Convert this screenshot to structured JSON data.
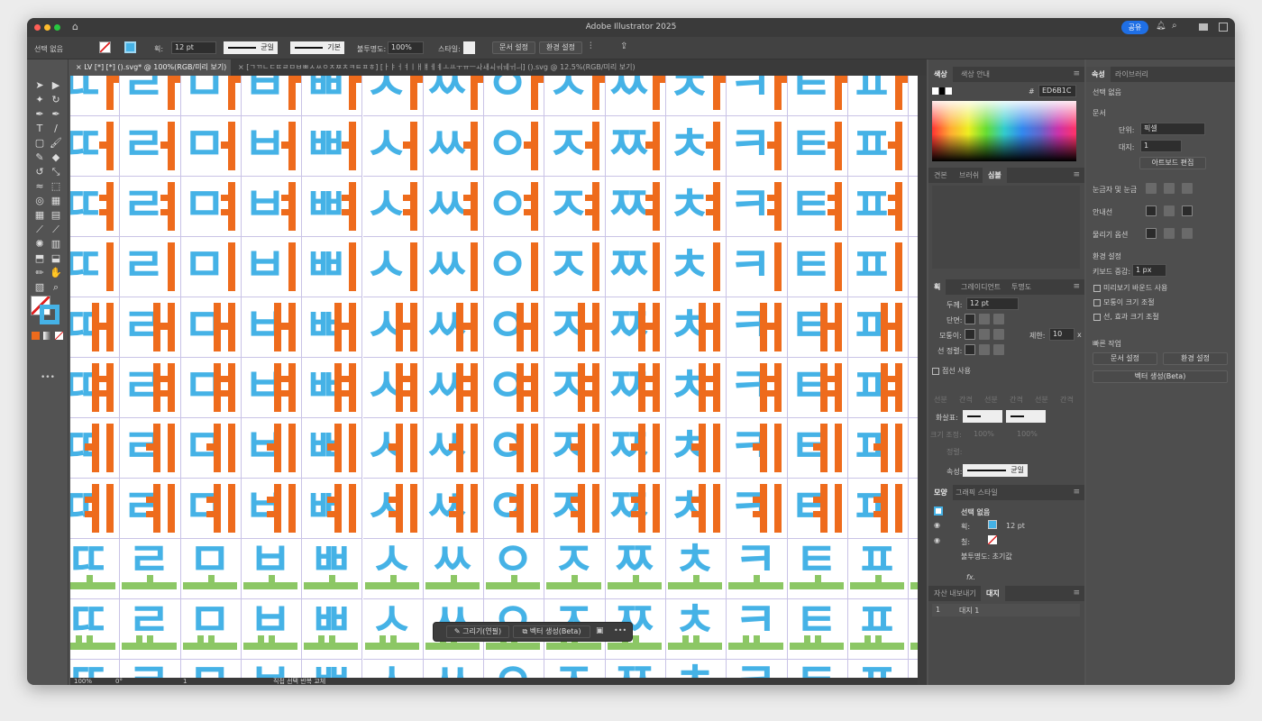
{
  "app": {
    "title": "Adobe Illustrator 2025",
    "share_label": "공유"
  },
  "control_bar": {
    "selection": "선택 없음",
    "stroke_label": "획:",
    "stroke_weight": "12 pt",
    "stroke_profile": "균일",
    "brush": "기본",
    "opacity_label": "불투명도:",
    "opacity": "100%",
    "style_label": "스타일:",
    "doc_setup": "문서 설정",
    "preferences": "환경 설정"
  },
  "tabs": [
    {
      "label": "LV [*] [*] ().svg* @ 100%(RGB/미리 보기)",
      "active": true
    },
    {
      "label": "[ㄱㄲㄴㄷㄸㄹㅁㅂㅃㅅㅆㅇㅈㅉㅊㅋㅌㅍㅎ] [ㅏㅑㅓㅕㅣㅐㅒㅔㅖㅗㅛㅜㅠㅡㅘㅙㅚㅝㅞㅟㅢ] ().svg @ 12.5%(RGB/미리 보기)",
      "active": false
    }
  ],
  "canvas": {
    "consonants": [
      "ㄸ",
      "ㄹ",
      "ㅁ",
      "ㅂ",
      "ㅃ",
      "ㅅ",
      "ㅆ",
      "ㅇ",
      "ㅈ",
      "ㅉ",
      "ㅊ",
      "ㅋ",
      "ㅌ",
      "ㅍ",
      "ㅎ"
    ],
    "vowels": [
      "ㅏ",
      "ㅓ",
      "ㅕ",
      "ㅣ",
      "ㅐ",
      "ㅒ",
      "ㅔ",
      "ㅖ",
      "ㅗ",
      "ㅛ",
      "ㅜ"
    ],
    "colors": {
      "consonant": "#45b2e6",
      "vowel": "#ee6b1c",
      "horizontal_vowel": "#8cc765"
    }
  },
  "status_bar": {
    "zoom": "100%",
    "rotation": "0°",
    "artboard": "1",
    "tool": "직접 선택 반복 교체"
  },
  "floating_bar": {
    "draw": "그리기(연필)",
    "vectorize": "벡터 생성(Beta)",
    "more": "•••"
  },
  "color_panel": {
    "tabs": [
      "색상",
      "색상 안내"
    ],
    "hex_label": "#",
    "hex": "ED6B1C"
  },
  "swatch_panel": {
    "tabs": [
      "견본",
      "브러쉬",
      "심볼"
    ]
  },
  "stroke_panel": {
    "tabs": [
      "획",
      "그레이디언트",
      "투명도"
    ],
    "weight_label": "두께:",
    "weight": "12 pt",
    "cap_label": "단면:",
    "corner_label": "모퉁이:",
    "limit_label": "제한:",
    "limit": "10",
    "limit_unit": "x",
    "align_label": "선 정렬:",
    "dashed": "점선 사용",
    "dash_labels": [
      "선분",
      "간격",
      "선분",
      "간격",
      "선분",
      "간격"
    ],
    "arrow_label": "화살표:",
    "scale_label": "크기 조정:",
    "scale1": "100%",
    "scale2": "100%",
    "align2_label": "정렬:",
    "profile_label": "속성:",
    "profile": "균일"
  },
  "appearance_panel": {
    "tabs": [
      "모양",
      "그래픽 스타일"
    ],
    "title": "선택 없음",
    "stroke_label": "획:",
    "stroke_value": "12 pt",
    "fill_label": "칠:",
    "opacity": "불투명도: 초기값",
    "fx": "fx."
  },
  "artboard_panel": {
    "tabs": [
      "자산 내보내기",
      "대지"
    ],
    "rows": [
      {
        "num": "1",
        "name": "대지 1"
      }
    ]
  },
  "properties_panel": {
    "tabs": [
      "속성",
      "라이브러리"
    ],
    "selection": "선택 없음",
    "document": "문서",
    "units_label": "단위:",
    "units": "픽셀",
    "artboard_label": "대지:",
    "artboard": "1",
    "edit_artboards": "아트보드 편집",
    "rulers_grids": "눈금자 및 눈금",
    "guides": "안내선",
    "snap": "물리기 옵션",
    "preferences": "환경 설정",
    "keyboard_inc_label": "키보드 증감:",
    "keyboard_inc": "1 px",
    "check1": "미리보기 바운드 사용",
    "check2": "모퉁이 크기 조절",
    "check3": "선, 효과 크기 조절",
    "quick_actions": "빠른 작업",
    "doc_setup": "문서 설정",
    "prefs": "환경 설정",
    "vectorize": "벡터 생성(Beta)"
  }
}
